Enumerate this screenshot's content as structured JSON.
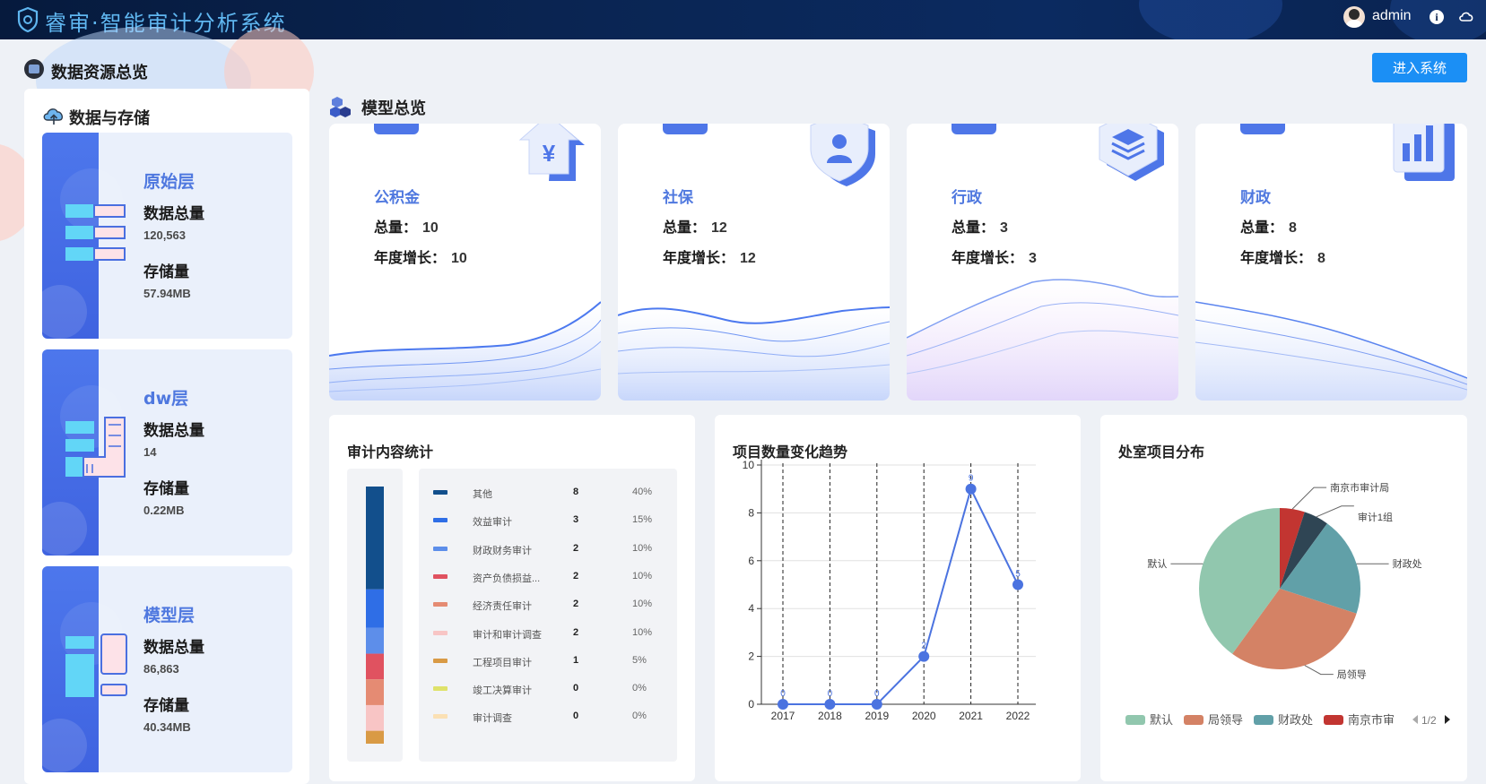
{
  "header": {
    "title": "睿审·智能审计分析系统",
    "username": "admin",
    "info_glyph": "i"
  },
  "overview": {
    "title": "数据资源总览",
    "enter_button": "进入系统"
  },
  "storage": {
    "title": "数据与存储",
    "layers": [
      {
        "name": "原始层",
        "count_label": "数据总量",
        "count": "120,563",
        "size_label": "存储量",
        "size": "57.94MB"
      },
      {
        "name": "dw层",
        "count_label": "数据总量",
        "count": "14",
        "size_label": "存储量",
        "size": "0.22MB"
      },
      {
        "name": "模型层",
        "count_label": "数据总量",
        "count": "86,863",
        "size_label": "存储量",
        "size": "40.34MB"
      }
    ]
  },
  "models": {
    "title": "模型总览",
    "cards": [
      {
        "name": "公积金",
        "total_label": "总量：",
        "total": "10",
        "growth_label": "年度增长：",
        "growth": "10",
        "icon": "yen-house-icon"
      },
      {
        "name": "社保",
        "total_label": "总量：",
        "total": "12",
        "growth_label": "年度增长：",
        "growth": "12",
        "icon": "user-shield-icon"
      },
      {
        "name": "行政",
        "total_label": "总量：",
        "total": "3",
        "growth_label": "年度增长：",
        "growth": "3",
        "icon": "layers-icon"
      },
      {
        "name": "财政",
        "total_label": "总量：",
        "total": "8",
        "growth_label": "年度增长：",
        "growth": "8",
        "icon": "bar-chart-icon"
      }
    ]
  },
  "audit_stats": {
    "title": "审计内容统计",
    "items": [
      {
        "name": "其他",
        "count": "8",
        "pct": "40%",
        "value": 8,
        "color": "#124f8c"
      },
      {
        "name": "效益审计",
        "count": "3",
        "pct": "15%",
        "value": 3,
        "color": "#2f6ee6"
      },
      {
        "name": "财政财务审计",
        "count": "2",
        "pct": "10%",
        "value": 2,
        "color": "#5d8eea"
      },
      {
        "name": "资产负债损益...",
        "count": "2",
        "pct": "10%",
        "value": 2,
        "color": "#e05260"
      },
      {
        "name": "经济责任审计",
        "count": "2",
        "pct": "10%",
        "value": 2,
        "color": "#e58b73"
      },
      {
        "name": "审计和审计调查",
        "count": "2",
        "pct": "10%",
        "value": 2,
        "color": "#f8c5c5"
      },
      {
        "name": "工程项目审计",
        "count": "1",
        "pct": "5%",
        "value": 1,
        "color": "#d99a45"
      },
      {
        "name": "竣工决算审计",
        "count": "0",
        "pct": "0%",
        "value": 0,
        "color": "#dfe26a"
      },
      {
        "name": "审计调查",
        "count": "0",
        "pct": "0%",
        "value": 0,
        "color": "#fbe0b4"
      }
    ]
  },
  "trend": {
    "title": "项目数量变化趋势"
  },
  "distribution": {
    "title": "处室项目分布",
    "pager": "1/2"
  },
  "chart_data": [
    {
      "type": "line",
      "title": "项目数量变化趋势",
      "x": [
        "2017",
        "2018",
        "2019",
        "2020",
        "2021",
        "2022"
      ],
      "series": [
        {
          "values": [
            0,
            0,
            0,
            2,
            9,
            5
          ]
        }
      ],
      "ylim": [
        0,
        10
      ],
      "yticks": [
        "0",
        "2",
        "4",
        "6",
        "8",
        "10"
      ],
      "point_labels": [
        "0",
        "0",
        "0",
        "2",
        "9",
        "5"
      ],
      "grid": true,
      "color": "#4b73e0"
    },
    {
      "type": "pie",
      "title": "处室项目分布",
      "labels": [
        "南京市审计局",
        "审计1组",
        "财政处",
        "局领导",
        "默认"
      ],
      "values": [
        1,
        1,
        4,
        6,
        8
      ],
      "colors": [
        "#c23531",
        "#2f4554",
        "#61a0a8",
        "#d48265",
        "#91c7ae"
      ],
      "legend": [
        "默认",
        "局领导",
        "财政处",
        "南京市审"
      ],
      "legend_colors": [
        "#91c7ae",
        "#d48265",
        "#61a0a8",
        "#c23531"
      ],
      "legend_position": "bottom"
    }
  ]
}
